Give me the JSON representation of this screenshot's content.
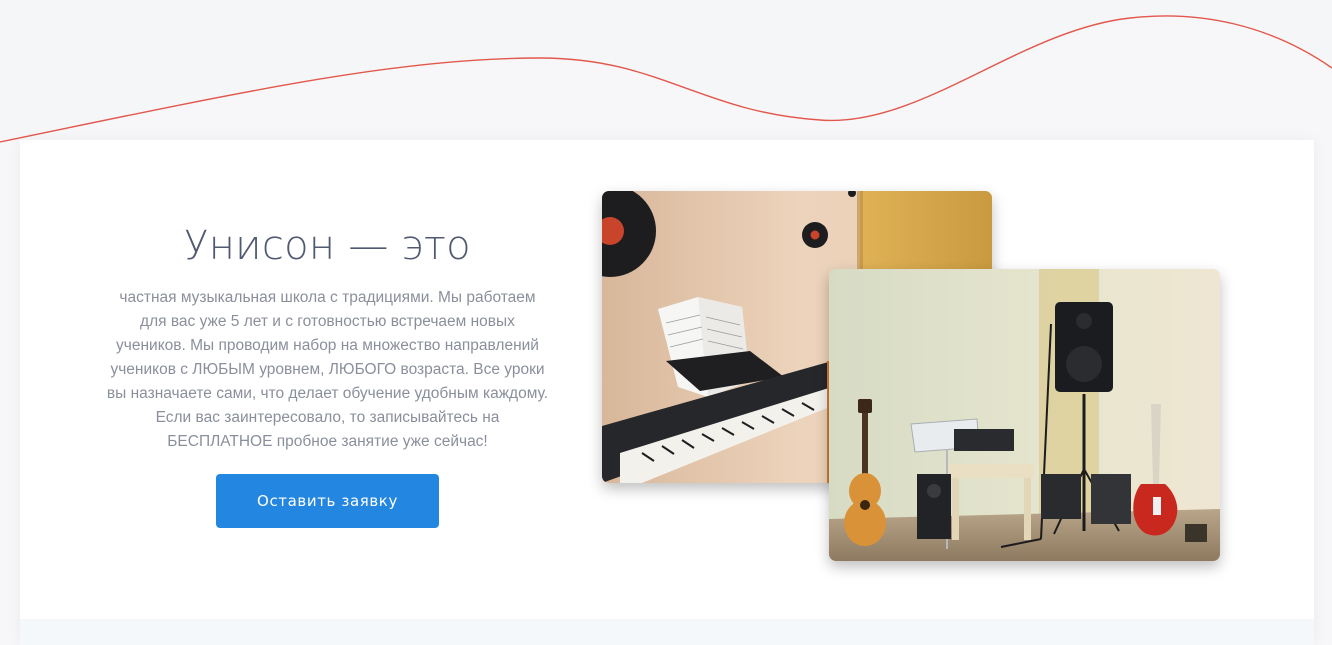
{
  "hero": {
    "wave_color": "#e2584c"
  },
  "about": {
    "title": "Унисон — это",
    "description": "частная музыкальная школа с традициями. Мы работаем для вас уже 5 лет и с готовностью встречаем новых учеников. Мы проводим набор на множество направлений учеников с ЛЮБЫМ уровнем, ЛЮБОГО возраста. Все уроки вы назначаете сами, что делает обучение удобным каждому. Если вас заинтересовало, то записывайтесь на БЕСПЛАТНОЕ пробное занятие уже сейчас!",
    "cta_label": "Оставить заявку",
    "accent_color": "#2386e0"
  },
  "gallery": {
    "photos": [
      {
        "subject": "piano-room"
      },
      {
        "subject": "stage-with-guitars-and-speaker"
      }
    ]
  }
}
